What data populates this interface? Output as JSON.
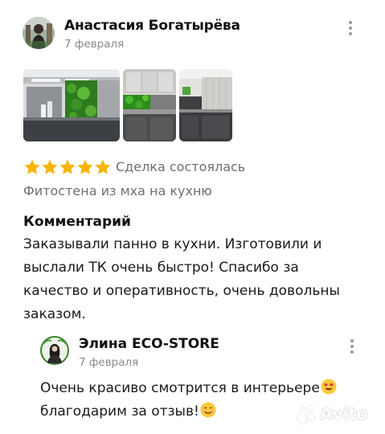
{
  "review": {
    "author_name": "Анастасия Богатырёва",
    "date": "7 февраля",
    "photos": [
      {
        "subject": "kitchen-moss-wall-photo"
      },
      {
        "subject": "moss-panel-kitchen-photo"
      },
      {
        "subject": "kitchen-interior-photo"
      }
    ],
    "rating": 5,
    "max_rating": 5,
    "deal_status": "Сделка состоялась",
    "item_title": "Фитостена из мха на кухню",
    "comment_heading": "Комментарий",
    "comment_lines": [
      "Заказывали панно в кухни. Изготовили и",
      "выслали ТК очень быстро! Спасибо за",
      "качество и оперативность, очень довольны",
      "заказом."
    ]
  },
  "reply": {
    "author_name": "Элина ECO-STORE",
    "date": "7 февраля",
    "text_line1": "Очень красиво смотрится в интерьере",
    "text_line2": "благодарим за отзыв!",
    "emoji1": "heart-eyes-emoji",
    "emoji2": "smiling-face-emoji"
  },
  "watermark": {
    "text": "Avito"
  },
  "colors": {
    "star": "#f7b500",
    "secondary_text": "#8a8a8a",
    "muted_text": "#6f6f6f",
    "moss_green": "#3f8f2a"
  }
}
